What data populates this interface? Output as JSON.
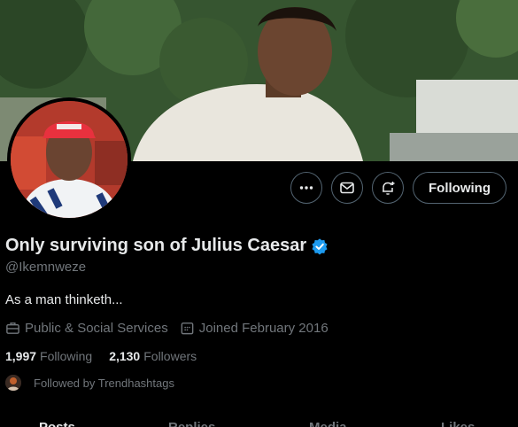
{
  "profile": {
    "display_name": "Only surviving son of Julius Caesar",
    "handle": "@Ikemnweze",
    "bio": "As a man thinketh...",
    "category": "Public & Social Services",
    "joined": "Joined February 2016",
    "verified": true
  },
  "stats": {
    "following_count": "1,997",
    "following_label": "Following",
    "followers_count": "2,130",
    "followers_label": "Followers"
  },
  "followed_by": "Followed by Trendhashtags",
  "actions": {
    "more_icon": "more-horizontal-icon",
    "message_icon": "mail-icon",
    "notify_icon": "bell-plus-icon",
    "follow_label": "Following"
  },
  "tabs": [
    "Posts",
    "Replies",
    "Media",
    "Likes"
  ],
  "colors": {
    "background": "#000000",
    "verified_blue": "#1d9bf0",
    "muted_text": "#71767b",
    "primary_text": "#e7e9ea",
    "button_border": "#536471"
  }
}
